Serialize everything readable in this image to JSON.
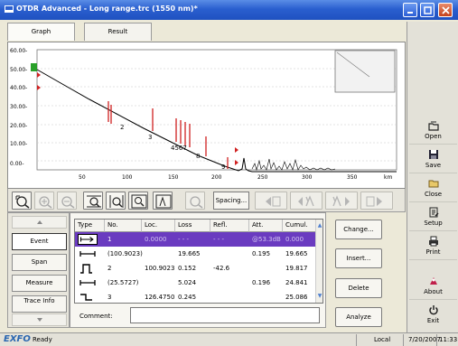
{
  "window": {
    "title": "OTDR Advanced - Long range.trc (1550 nm)*"
  },
  "tabs": [
    {
      "label": "Graph"
    },
    {
      "label": "Result"
    }
  ],
  "graph": {
    "y_ticks": [
      "60.00-",
      "50.00-",
      "40.00-",
      "30.00-",
      "20.00-",
      "10.00-",
      "0.00-"
    ],
    "x_ticks": [
      "50",
      "100",
      "150",
      "200",
      "250",
      "300",
      "350",
      "km"
    ],
    "event_labels": [
      "2",
      "3",
      "4567",
      "8",
      "9"
    ],
    "trace_color": "#000000",
    "event_marker_color": "#d02020",
    "start_marker_color": "#2aa02a"
  },
  "toolbar": {
    "spacing_label": "Spacing..."
  },
  "nav": {
    "items": [
      {
        "label": "Event"
      },
      {
        "label": "Span"
      },
      {
        "label": "Measure"
      },
      {
        "label": "Trace Info"
      }
    ]
  },
  "events_table": {
    "columns": [
      "Type",
      "No.",
      "Loc.",
      "Loss",
      "Refl.",
      "Att.",
      "Cumul."
    ],
    "rows": [
      {
        "type_icon": "launch-arrow-icon",
        "no": "1",
        "loc": "0.0000",
        "loss": "- - -",
        "refl": "- - -",
        "att": "@53.3dB",
        "cumul": "0.000",
        "selected": true
      },
      {
        "type_icon": "span-icon",
        "no": "(100.9023)",
        "loc": "",
        "loss": "19.665",
        "refl": "",
        "att": "0.195",
        "cumul": "19.665",
        "selected": false
      },
      {
        "type_icon": "reflective-event-icon",
        "no": "2",
        "loc": "100.9023",
        "loss": "0.152",
        "refl": "-42.6",
        "att": "",
        "cumul": "19.817",
        "selected": false
      },
      {
        "type_icon": "span-icon",
        "no": "(25.5727)",
        "loc": "",
        "loss": "5.024",
        "refl": "",
        "att": "0.196",
        "cumul": "24.841",
        "selected": false
      },
      {
        "type_icon": "non-reflective-event-icon",
        "no": "3",
        "loc": "126.4750",
        "loss": "0.245",
        "refl": "",
        "att": "",
        "cumul": "25.086",
        "selected": false
      }
    ],
    "comment_label": "Comment:",
    "comment_value": ""
  },
  "actions": {
    "change": "Change...",
    "insert": "Insert...",
    "delete": "Delete",
    "analyze": "Analyze"
  },
  "sidebar": {
    "items": [
      {
        "label": "Open"
      },
      {
        "label": "Save"
      },
      {
        "label": "Close"
      },
      {
        "label": "Setup"
      },
      {
        "label": "Print"
      },
      {
        "label": "About"
      },
      {
        "label": "Exit"
      }
    ]
  },
  "statusbar": {
    "logo": "EXFO",
    "status": "Ready",
    "mode": "Local",
    "date": "7/20/2007",
    "time": "11:33 A"
  }
}
